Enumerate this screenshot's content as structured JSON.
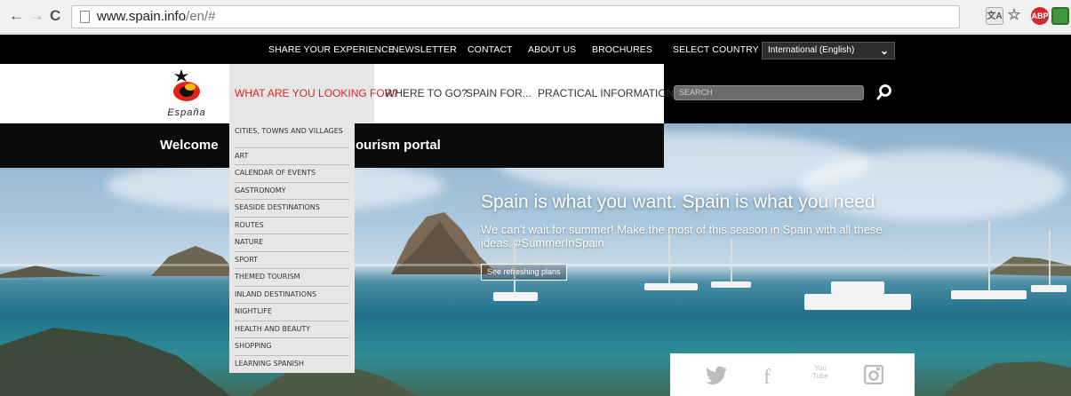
{
  "browser": {
    "url_domain": "www.spain.info",
    "url_path": "/en/#",
    "back_icon": "←",
    "forward_icon": "→",
    "reload_icon": "C",
    "star_icon": "☆",
    "abp_label": "ABP"
  },
  "topbar": {
    "links": [
      "SHARE YOUR EXPERIENCE",
      "NEWSLETTER",
      "CONTACT",
      "ABOUT US",
      "BROCHURES"
    ],
    "select_country_label": "SELECT COUNTRY",
    "country_value": "International (English)"
  },
  "logo": {
    "text": "España"
  },
  "nav": {
    "items": [
      "WHAT ARE YOU LOOKING FOR?",
      "WHERE TO GO?",
      "SPAIN FOR...",
      "PRACTICAL INFORMATION"
    ],
    "active_index": 0,
    "search_placeholder": "SEARCH"
  },
  "dropdown": {
    "items": [
      "Cities, towns and villages",
      "Art",
      "Calendar of events",
      "Gastronomy",
      "Seaside destinations",
      "Routes",
      "Nature",
      "Sport",
      "Themed tourism",
      "Inland destinations",
      "Nightlife",
      "Health and beauty",
      "Shopping",
      "Learning Spanish"
    ]
  },
  "welcome": {
    "text_left": "Welcome",
    "text_right": "ourism portal"
  },
  "hero": {
    "title": "Spain is what you want. Spain is what you need",
    "subtitle": "We can't wait for summer! Make the most of this season in Spain with all these ideas. #SummerInSpain",
    "button_label": "See refreshing plans"
  },
  "social": {
    "twitter_icon": "twitter-icon",
    "facebook_label": "f",
    "youtube_label": "You Tube",
    "instagram_icon": "instagram-icon"
  },
  "colors": {
    "accent": "#d8262d",
    "nav_text": "#333333",
    "dropdown_bg": "#e6e6e6"
  }
}
